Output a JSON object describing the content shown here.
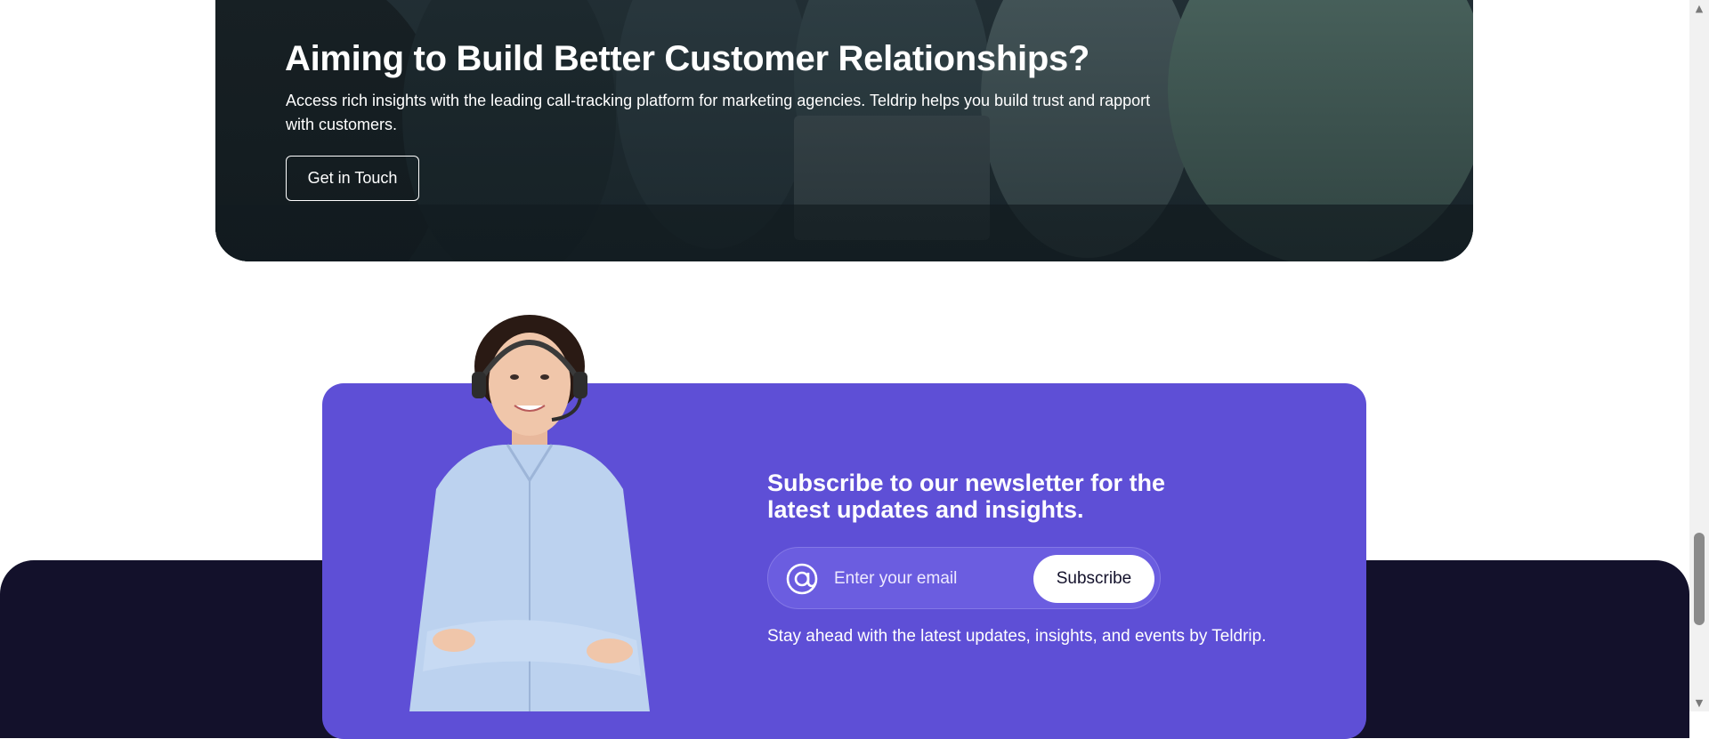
{
  "hero": {
    "title": "Aiming to Build Better Customer Relationships?",
    "description": "Access rich insights with the leading call-tracking platform for marketing agencies. Teldrip helps you build trust and rapport with customers.",
    "cta_label": "Get in Touch"
  },
  "newsletter": {
    "title": "Subscribe to our newsletter for the latest updates and insights.",
    "email_placeholder": "Enter your email",
    "email_value": "",
    "subscribe_label": "Subscribe",
    "note": "Stay ahead with the latest updates, insights, and events by Teldrip.",
    "icon": "at-sign-icon"
  },
  "colors": {
    "newsletter_bg": "#5e4fd6",
    "footer_bg": "#13112b",
    "hero_text": "#ffffff"
  }
}
